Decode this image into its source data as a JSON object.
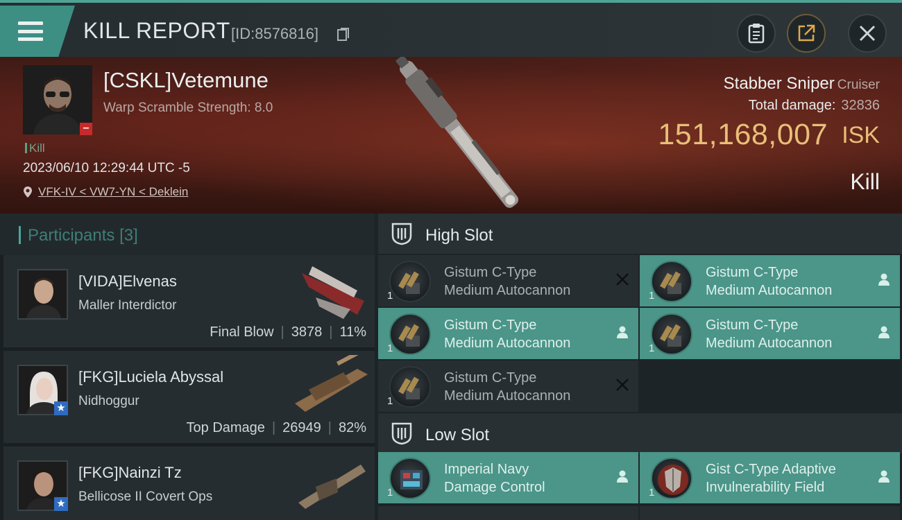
{
  "header": {
    "title": "KILL REPORT",
    "id_text": "[ID:8576816]",
    "icons": [
      "menu-icon",
      "clipboard-icon",
      "share-icon",
      "close-icon"
    ]
  },
  "victim": {
    "name": "[CSKL]Vetemune",
    "warp_scramble": "Warp Scramble Strength: 8.0",
    "tag": "Kill",
    "datetime": "2023/06/10 12:29:44 UTC -5",
    "location": "VFK-IV < VW7-YN < Deklein",
    "ship_name": "Stabber Sniper",
    "ship_class": "Cruiser",
    "total_damage_label": "Total damage:",
    "total_damage_value": "32836",
    "isk_value": "151,168,007",
    "isk_unit": "ISK",
    "result": "Kill"
  },
  "participants": {
    "title": "Participants",
    "count": "[3]",
    "items": [
      {
        "name": "[VIDA]Elvenas",
        "ship": "Maller Interdictor",
        "label": "Final Blow",
        "damage": "3878",
        "percent": "11%"
      },
      {
        "name": "[FKG]Luciela Abyssal",
        "ship": "Nidhoggur",
        "label": "Top Damage",
        "damage": "26949",
        "percent": "82%"
      },
      {
        "name": "[FKG]Nainzi Tz",
        "ship": "Bellicose II Covert Ops",
        "label": "",
        "damage": "",
        "percent": ""
      }
    ]
  },
  "fitting": {
    "high_slot": {
      "title": "High Slot",
      "modules": [
        {
          "line1": "Gistum C-Type",
          "line2": "Medium Autocannon",
          "qty": "1",
          "state": "destroyed"
        },
        {
          "line1": "Gistum C-Type",
          "line2": "Medium Autocannon",
          "qty": "1",
          "state": "dropped"
        },
        {
          "line1": "Gistum C-Type",
          "line2": "Medium Autocannon",
          "qty": "1",
          "state": "dropped"
        },
        {
          "line1": "Gistum C-Type",
          "line2": "Medium Autocannon",
          "qty": "1",
          "state": "dropped"
        },
        {
          "line1": "Gistum C-Type",
          "line2": "Medium Autocannon",
          "qty": "1",
          "state": "destroyed"
        }
      ]
    },
    "low_slot": {
      "title": "Low Slot",
      "modules": [
        {
          "line1": "Imperial Navy",
          "line2": "Damage Control",
          "qty": "1",
          "state": "dropped"
        },
        {
          "line1": "Gist C-Type Adaptive",
          "line2": "Invulnerability Field",
          "qty": "1",
          "state": "dropped"
        }
      ]
    }
  },
  "colors": {
    "accent": "#4b9589",
    "isk": "#e8bf78",
    "banner": "#4a1e17"
  }
}
